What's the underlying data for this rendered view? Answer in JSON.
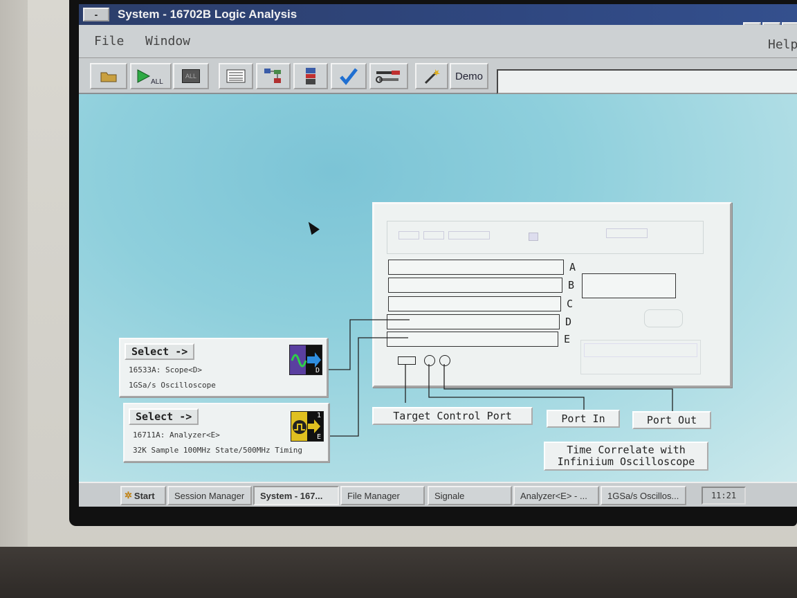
{
  "window": {
    "system_menu_label": "-",
    "title": "System - 16702B Logic Analysis",
    "controls": [
      "_",
      "□",
      "×"
    ]
  },
  "menubar": {
    "file": "File",
    "window": "Window",
    "help": "Help"
  },
  "toolbar": {
    "run_all_label": "ALL",
    "stop_all_label": "ALL",
    "demo_label": "Demo"
  },
  "frame": {
    "slots": [
      "A",
      "B",
      "C",
      "D",
      "E"
    ]
  },
  "modules": [
    {
      "select_label": "Select ->",
      "name": "16533A: Scope<D>",
      "description": "1GSa/s Oscilloscope",
      "slot_letter": "D"
    },
    {
      "select_label": "Select ->",
      "name": "16711A: Analyzer<E>",
      "description": "32K Sample 100MHz State/500MHz Timing",
      "slot_number": "1",
      "slot_letter": "E"
    }
  ],
  "ports": {
    "target_control": "Target Control Port",
    "port_in": "Port In",
    "port_out": "Port Out",
    "time_correlate_line1": "Time Correlate with",
    "time_correlate_line2": "Infiniium Oscilloscope"
  },
  "taskbar": {
    "start": "Start",
    "tasks": [
      "Session Manager",
      "System - 167...",
      "File Manager",
      "Signale",
      "Analyzer<E> - ...",
      "1GSa/s Oscillos..."
    ],
    "clock": "11:21"
  },
  "colors": {
    "titlebar": "#2f4780",
    "desktop": "#8ecfdc",
    "check": "#1f6fd1"
  }
}
